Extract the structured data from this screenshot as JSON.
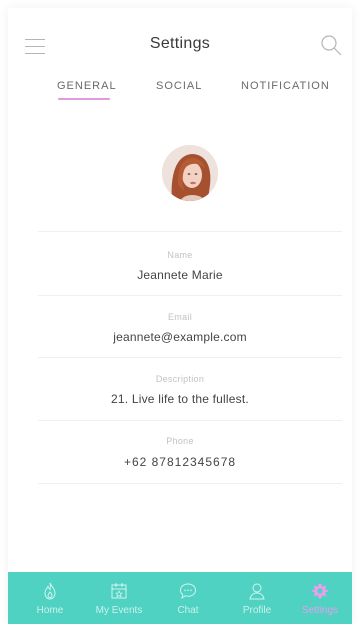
{
  "header": {
    "title": "Settings",
    "menu_icon": "hamburger-menu-icon",
    "search_icon": "search-icon"
  },
  "tabs": [
    {
      "label": "GENERAL",
      "active": true
    },
    {
      "label": "SOCIAL",
      "active": false
    },
    {
      "label": "NOTIFICATION",
      "active": false
    }
  ],
  "profile": {
    "avatar_icon": "avatar-photo",
    "fields": [
      {
        "label": "Name",
        "value": "Jeannete Marie"
      },
      {
        "label": "Email",
        "value": "jeannete@example.com"
      },
      {
        "label": "Description",
        "value": "21. Live life to the fullest."
      },
      {
        "label": "Phone",
        "value": "+62 87812345678"
      }
    ]
  },
  "bottom_nav": {
    "items": [
      {
        "label": "Home",
        "icon": "flame-icon"
      },
      {
        "label": "My Events",
        "icon": "calendar-icon"
      },
      {
        "label": "Chat",
        "icon": "chat-bubble-icon"
      },
      {
        "label": "Profile",
        "icon": "person-icon"
      },
      {
        "label": "Settings",
        "icon": "gear-icon",
        "active": true
      }
    ]
  },
  "colors": {
    "accent": "#e29cdd",
    "nav_background": "#4fd2c2",
    "active_nav": "#e7a0e9"
  }
}
